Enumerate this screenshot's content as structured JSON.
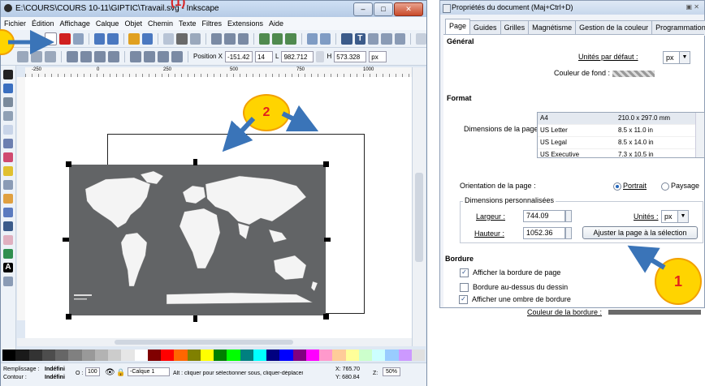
{
  "inkscape": {
    "title": "E:\\COURS\\COURS 10-11\\GIPTIC\\Travail.svg - Inkscape",
    "menu": [
      "Fichier",
      "Édition",
      "Affichage",
      "Calque",
      "Objet",
      "Chemin",
      "Texte",
      "Filtres",
      "Extensions",
      "Aide"
    ],
    "toolbar2": {
      "position_label": "Position X",
      "x_value": "-151.42",
      "y_value": "14",
      "width_label": "L",
      "width_value": "982.712",
      "height_label": "H",
      "height_value": "573.328",
      "unit": "px"
    },
    "ruler_marks": [
      "-250",
      "0",
      "250",
      "500",
      "750",
      "1000"
    ],
    "status": {
      "fill_label": "Remplissage :",
      "fill_value": "Indéfini",
      "stroke_label": "Contour :",
      "stroke_value": "Indéfini",
      "opacity_label": "O :",
      "opacity_value": "100",
      "layer": "-Calque 1",
      "hint": "Alt : cliquer pour sélectionner sous, cliquer-déplacer pour",
      "x": "X:  765.70",
      "y": "Y:  680.84",
      "zoom_label": "Z:",
      "zoom_value": "50%"
    },
    "palette_colors": [
      "#000000",
      "#1a1a1a",
      "#333333",
      "#4d4d4d",
      "#666666",
      "#808080",
      "#999999",
      "#b3b3b3",
      "#cccccc",
      "#e6e6e6",
      "#ffffff",
      "#800000",
      "#ff0000",
      "#ff6600",
      "#808000",
      "#ffff00",
      "#008000",
      "#00ff00",
      "#008080",
      "#00ffff",
      "#000080",
      "#0000ff",
      "#800080",
      "#ff00ff",
      "#ff99cc",
      "#ffcc99",
      "#ffff99",
      "#ccffcc",
      "#ccffff",
      "#99ccff",
      "#cc99ff",
      "#e0e0e0"
    ]
  },
  "dialog": {
    "title": "Propriétés du document (Maj+Ctrl+D)",
    "tabs": [
      "Page",
      "Guides",
      "Grilles",
      "Magnétisme",
      "Gestion de la couleur",
      "Programmation"
    ],
    "general_header": "Général",
    "default_units_label": "Unités par défaut :",
    "default_units_value": "px",
    "background_color_label": "Couleur de fond :",
    "format_header": "Format",
    "page_size_label": "Dimensions de la page :",
    "page_sizes": [
      {
        "name": "A4",
        "dims": "210.0 x 297.0 mm"
      },
      {
        "name": "US Letter",
        "dims": "8.5 x 11.0 in"
      },
      {
        "name": "US Legal",
        "dims": "8.5 x 14.0 in"
      },
      {
        "name": "US Executive",
        "dims": "7.3 x 10.5 in"
      }
    ],
    "orientation_label": "Orientation de la page :",
    "portrait": "Portrait",
    "landscape": "Paysage",
    "custom_size_legend": "Dimensions personnalisées",
    "width_label": "Largeur :",
    "width_value": "744.09",
    "height_label": "Hauteur :",
    "height_value": "1052.36",
    "units_label": "Unités :",
    "units_value": "px",
    "fit_button": "Ajuster la page à la sélection",
    "border_header": "Bordure",
    "show_border": "Afficher la bordure de page",
    "border_on_top": "Bordure au-dessus du dessin",
    "show_shadow": "Afficher une ombre de bordure",
    "border_color_label": "Couleur de la bordure :"
  },
  "annotations": {
    "top_label": "(1)",
    "badge_1": "1",
    "badge_2": "2",
    "arrow_color": "#3a74b8",
    "badge_color": "#ffd400"
  }
}
